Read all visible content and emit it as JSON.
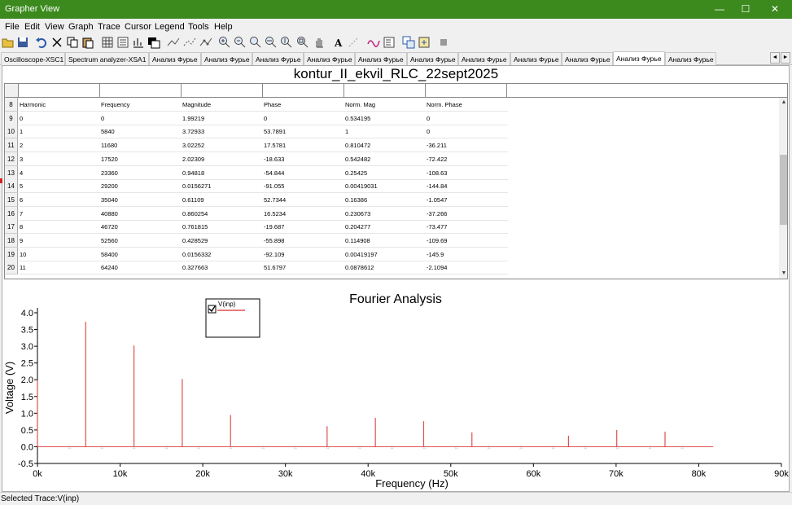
{
  "window": {
    "title": "Grapher View",
    "min_glyph": "—",
    "max_glyph": "☐",
    "close_glyph": "✕"
  },
  "menu": [
    "File",
    "Edit",
    "View",
    "Graph",
    "Trace",
    "Cursor",
    "Legend",
    "Tools",
    "Help"
  ],
  "toolbar_icons": [
    "open-icon",
    "save-icon",
    "undo-icon",
    "cut-icon",
    "copy-icon",
    "paste-icon",
    "grid-icon",
    "legend-icon",
    "toggle-chart-icon",
    "reverse-colors-icon",
    "line-style-icon",
    "cursor-icon",
    "cursor-points-icon",
    "zoom-in-icon",
    "zoom-out-icon",
    "zoom-area-icon",
    "zoom-x-icon",
    "zoom-y-icon",
    "zoom-fit-icon",
    "pan-icon",
    "text-icon",
    "select-marks-icon",
    "trace-icon",
    "properties-icon",
    "overlay-icon",
    "export-icon",
    "stop-icon"
  ],
  "tabs": [
    "Oscilloscope-XSC1",
    "Spectrum analyzer-XSA1",
    "Анализ Фурье",
    "Анализ Фурье",
    "Анализ Фурье",
    "Анализ Фурье",
    "Анализ Фурье",
    "Анализ Фурье",
    "Анализ Фурье",
    "Анализ Фурье",
    "Анализ Фурье",
    "Анализ Фурье",
    "Анализ Фурье",
    "Анализ Фурье"
  ],
  "active_tab": 12,
  "tab_nav": {
    "prev": "◄",
    "next": "►"
  },
  "table": {
    "title": "kontur_II_ekvil_RLC_22sept2025",
    "headers": [
      "Harmonic",
      "Frequency",
      "Magnitude",
      "Phase",
      "Norm. Mag",
      "Norm. Phase"
    ],
    "header_row_num": "8",
    "rows": [
      {
        "n": "9",
        "c": [
          "0",
          "0",
          "1.99219",
          "0",
          "0.534195",
          "0"
        ]
      },
      {
        "n": "10",
        "c": [
          "1",
          "5840",
          "3.72933",
          "53.7891",
          "1",
          "0"
        ]
      },
      {
        "n": "11",
        "c": [
          "2",
          "11680",
          "3.02252",
          "17.5781",
          "0.810472",
          "-36.211"
        ]
      },
      {
        "n": "12",
        "c": [
          "3",
          "17520",
          "2.02309",
          "-18.633",
          "0.542482",
          "-72.422"
        ]
      },
      {
        "n": "13",
        "c": [
          "4",
          "23360",
          "0.94818",
          "-54.844",
          "0.25425",
          "-108.63"
        ]
      },
      {
        "n": "14",
        "c": [
          "5",
          "29200",
          "0.0156271",
          "-91.055",
          "0.00419031",
          "-144.84"
        ]
      },
      {
        "n": "15",
        "c": [
          "6",
          "35040",
          "0.61109",
          "52.7344",
          "0.16386",
          "-1.0547"
        ]
      },
      {
        "n": "16",
        "c": [
          "7",
          "40880",
          "0.860254",
          "16.5234",
          "0.230673",
          "-37.266"
        ]
      },
      {
        "n": "17",
        "c": [
          "8",
          "46720",
          "0.761815",
          "-19.687",
          "0.204277",
          "-73.477"
        ]
      },
      {
        "n": "18",
        "c": [
          "9",
          "52560",
          "0.428529",
          "-55.898",
          "0.114908",
          "-109.69"
        ]
      },
      {
        "n": "19",
        "c": [
          "10",
          "58400",
          "0.0156332",
          "-92.109",
          "0.00419197",
          "-145.9"
        ]
      },
      {
        "n": "20",
        "c": [
          "11",
          "64240",
          "0.327663",
          "51.6797",
          "0.0878612",
          "-2.1094"
        ]
      }
    ]
  },
  "chart_data": {
    "type": "bar",
    "title": "Fourier Analysis",
    "xlabel": "Frequency (Hz)",
    "ylabel": "Voltage (V)",
    "xlim": [
      0,
      90000
    ],
    "ylim": [
      -0.5,
      4.0
    ],
    "x_ticks": [
      "0k",
      "10k",
      "20k",
      "30k",
      "40k",
      "50k",
      "60k",
      "70k",
      "80k",
      "90k"
    ],
    "y_ticks": [
      "-0.5",
      "0.0",
      "0.5",
      "1.0",
      "1.5",
      "2.0",
      "2.5",
      "3.0",
      "3.5",
      "4.0"
    ],
    "series": [
      {
        "name": "V(inp)",
        "color": "#e05050",
        "x": [
          0,
          5840,
          11680,
          17520,
          23360,
          29200,
          35040,
          40880,
          46720,
          52560,
          58400,
          64240,
          70080,
          75920
        ],
        "values": [
          1.99219,
          3.72933,
          3.02252,
          2.02309,
          0.94818,
          0.0156271,
          0.61109,
          0.860254,
          0.761815,
          0.428529,
          0.0156332,
          0.327663,
          0.5,
          0.45
        ]
      }
    ],
    "legend": {
      "entry": "V(inp)",
      "checked": true
    },
    "grid": false
  },
  "status": {
    "text": "Selected Trace:V(inp)"
  }
}
